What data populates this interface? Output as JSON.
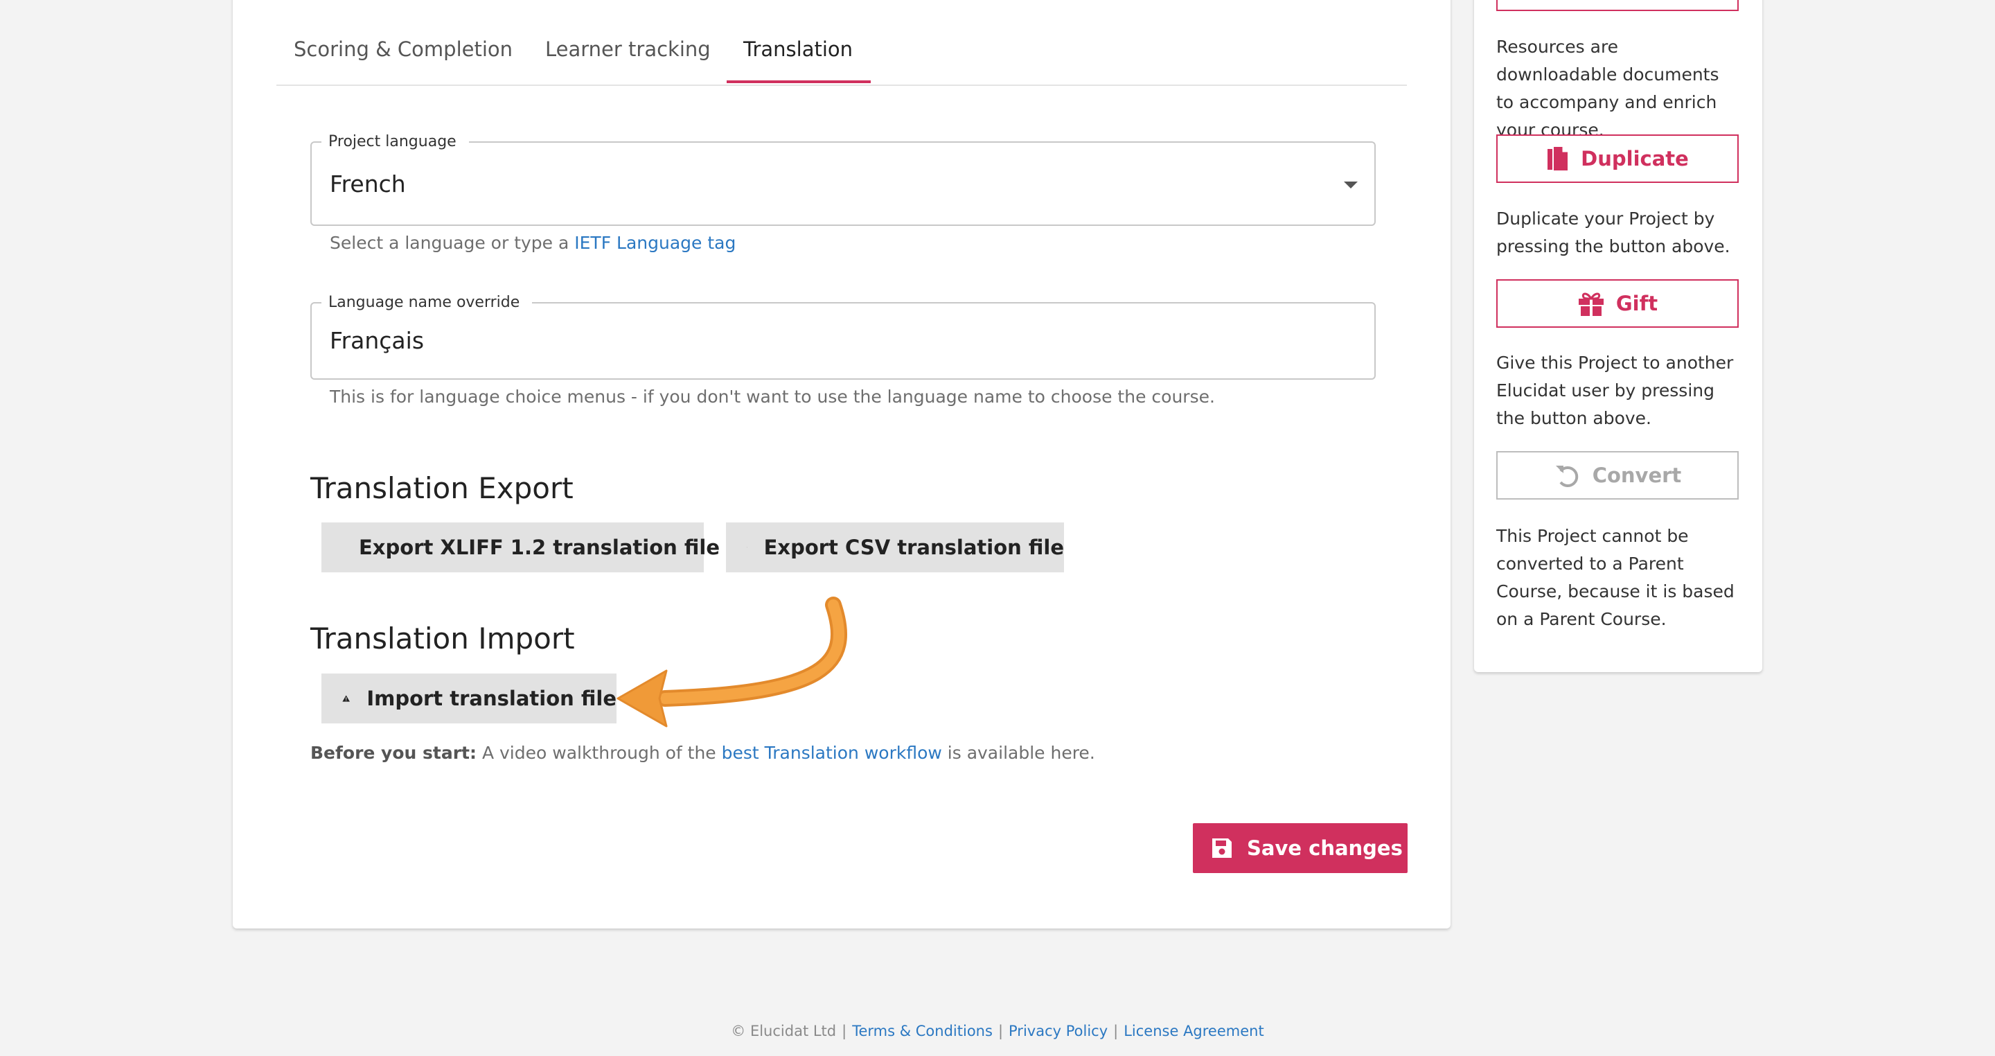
{
  "tabs": [
    {
      "label": "Scoring & Completion",
      "active": false
    },
    {
      "label": "Learner tracking",
      "active": false
    },
    {
      "label": "Translation",
      "active": true
    }
  ],
  "project_language": {
    "legend": "Project language",
    "value": "French",
    "helper_prefix": "Select a language or type a ",
    "helper_link": "IETF Language tag"
  },
  "language_override": {
    "legend": "Language name override",
    "value": "Français",
    "helper": "This is for language choice menus - if you don't want to use the language name to choose the course."
  },
  "translation_export": {
    "title": "Translation Export",
    "xliff_button": "Export XLIFF 1.2 translation file",
    "csv_button": "Export CSV translation file"
  },
  "translation_import": {
    "title": "Translation Import",
    "import_button": "Import translation file"
  },
  "note": {
    "bold": "Before you start:",
    "text_before": " A video walkthrough of the ",
    "link": "best Translation workflow",
    "text_after": " is available here."
  },
  "save_label": "Save changes",
  "sidebar": {
    "resources_text": "Resources are downloadable documents to accompany and enrich your course.",
    "duplicate_label": "Duplicate",
    "duplicate_text": "Duplicate your Project by pressing the button above.",
    "gift_label": "Gift",
    "gift_text": "Give this Project to another Elucidat user by pressing the button above.",
    "convert_label": "Convert",
    "convert_text": "This Project cannot be converted to a Parent Course, because it is based on a Parent Course."
  },
  "footer": {
    "copyright": "© Elucidat Ltd",
    "terms": "Terms & Conditions",
    "privacy": "Privacy Policy",
    "license": "License Agreement"
  },
  "colors": {
    "accent": "#d0305e",
    "link": "#2b78c2",
    "annotation_arrow": "#f09a38",
    "background": "#f3f3f3"
  }
}
